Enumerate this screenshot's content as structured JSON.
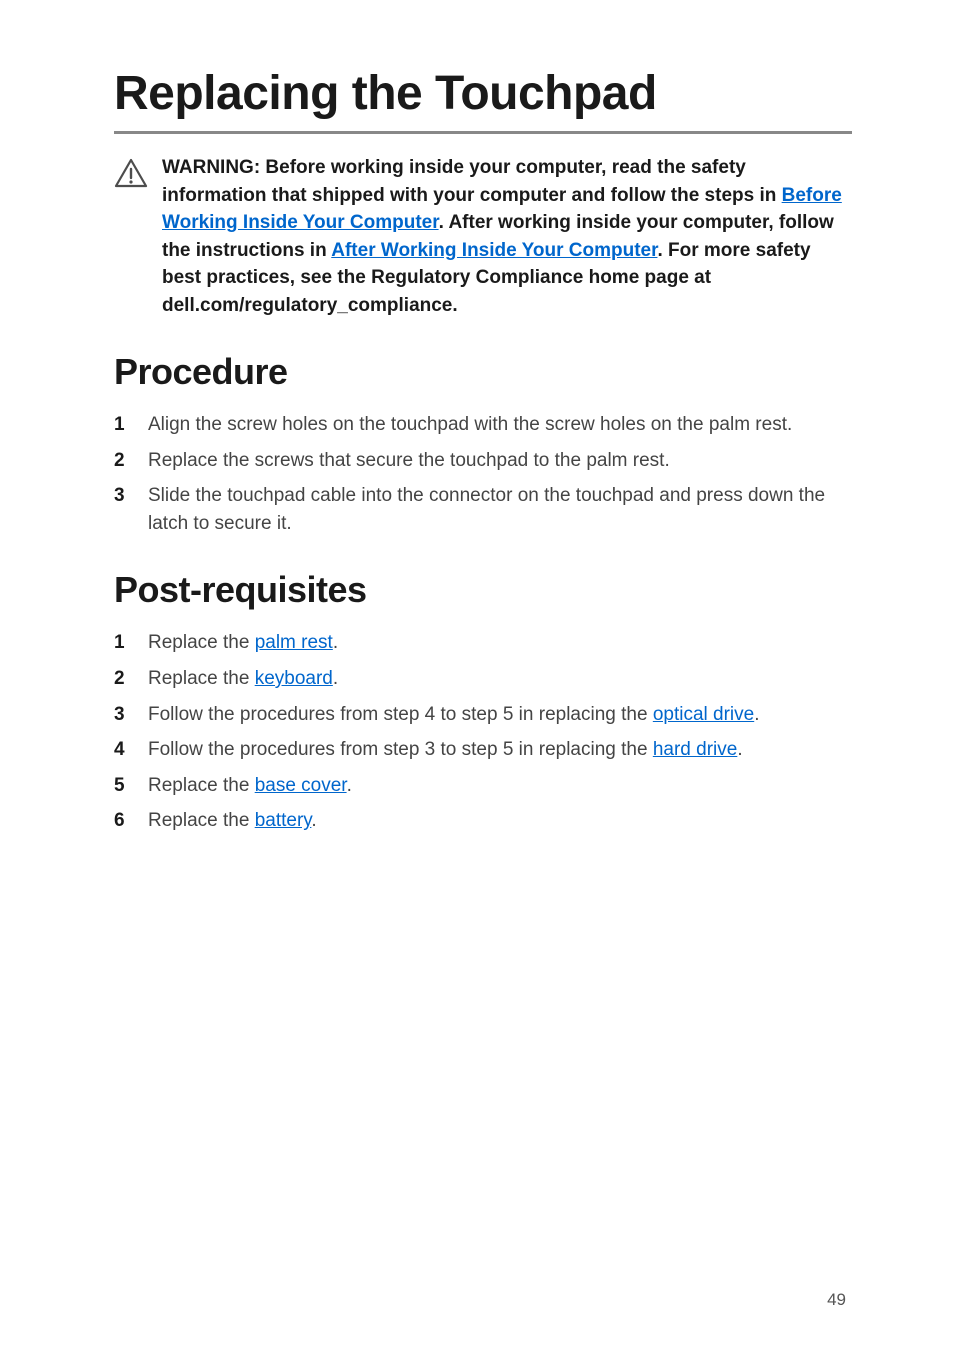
{
  "title": "Replacing the Touchpad",
  "warning": {
    "prefix": "WARNING: Before working inside your computer, read the safety information that shipped with your computer and follow the steps in ",
    "link1": "Before Working Inside Your Computer",
    "mid1": ". After working inside your computer, follow the instructions in ",
    "link2": "After Working Inside Your Computer",
    "suffix": ". For more safety best practices, see the Regulatory Compliance home page at dell.com/regulatory_compliance."
  },
  "procedure": {
    "heading": "Procedure",
    "steps": [
      "Align the screw holes on the touchpad with the screw holes on the palm rest.",
      "Replace the screws that secure the touchpad to the palm rest.",
      "Slide the touchpad cable into the connector on the touchpad and press down the latch to secure it."
    ]
  },
  "post": {
    "heading": "Post-requisites",
    "items": [
      {
        "pre": "Replace the ",
        "link": "palm rest",
        "post": "."
      },
      {
        "pre": "Replace the ",
        "link": "keyboard",
        "post": "."
      },
      {
        "pre": "Follow the procedures from step 4 to step 5 in replacing the ",
        "link": "optical drive",
        "post": "."
      },
      {
        "pre": "Follow the procedures from step 3 to step 5 in replacing the ",
        "link": "hard drive",
        "post": "."
      },
      {
        "pre": "Replace the ",
        "link": "base cover",
        "post": "."
      },
      {
        "pre": "Replace the ",
        "link": "battery",
        "post": "."
      }
    ]
  },
  "page_number": "49"
}
